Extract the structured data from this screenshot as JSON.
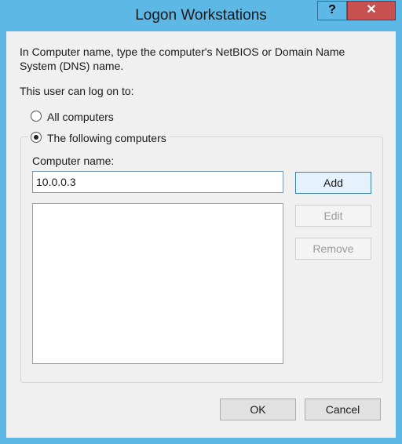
{
  "window": {
    "title": "Logon Workstations",
    "help_label": "?",
    "close_label": "✕"
  },
  "dialog": {
    "description": "In Computer name, type the computer's NetBIOS or Domain Name System (DNS) name.",
    "user_label": "This user can log on to:",
    "radio_all": "All computers",
    "radio_following": "The following computers",
    "selected_option": "The following computers",
    "computer_name_label": "Computer name:",
    "computer_name_value": "10.0.0.3",
    "list_items": [],
    "add_label": "Add",
    "edit_label": "Edit",
    "remove_label": "Remove",
    "ok_label": "OK",
    "cancel_label": "Cancel"
  },
  "colors": {
    "frame": "#5db8e6",
    "close": "#c75050"
  }
}
